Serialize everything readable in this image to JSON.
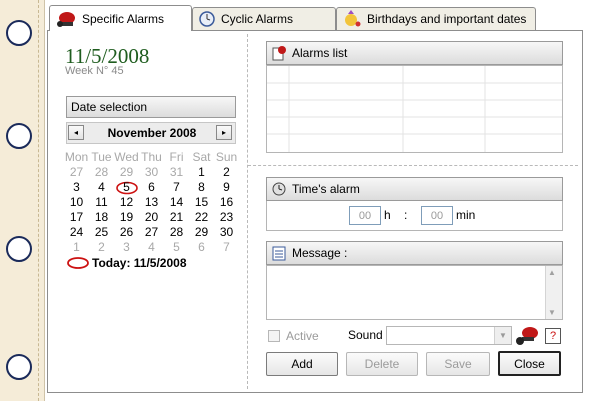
{
  "tabs": [
    {
      "label": "Specific Alarms",
      "icon": "alarm-bell-icon"
    },
    {
      "label": "Cyclic Alarms",
      "icon": "clock-icon"
    },
    {
      "label": "Birthdays and important dates",
      "icon": "birthday-icon"
    }
  ],
  "date_header": {
    "date": "11/5/2008",
    "week": "Week N° 45"
  },
  "date_selection": {
    "title": "Date selection",
    "month_label": "November 2008",
    "prev": "◂",
    "next": "▸"
  },
  "calendar": {
    "weekdays": [
      "Mon",
      "Tue",
      "Wed",
      "Thu",
      "Fri",
      "Sat",
      "Sun"
    ],
    "weeks": [
      [
        "27",
        "28",
        "29",
        "30",
        "31",
        "1",
        "2"
      ],
      [
        "3",
        "4",
        "5",
        "6",
        "7",
        "8",
        "9"
      ],
      [
        "10",
        "11",
        "12",
        "13",
        "14",
        "15",
        "16"
      ],
      [
        "17",
        "18",
        "19",
        "20",
        "21",
        "22",
        "23"
      ],
      [
        "24",
        "25",
        "26",
        "27",
        "28",
        "29",
        "30"
      ],
      [
        "1",
        "2",
        "3",
        "4",
        "5",
        "6",
        "7"
      ]
    ],
    "selected_day": "5",
    "today_label": "Today: 11/5/2008"
  },
  "alarms_list": {
    "title": "Alarms list"
  },
  "times_alarm": {
    "title": "Time's alarm",
    "hours": "00",
    "hours_unit": "h",
    "separator": ":",
    "minutes": "00",
    "minutes_unit": "min"
  },
  "message": {
    "title": "Message :"
  },
  "options": {
    "active_label": "Active",
    "sound_label": "Sound :",
    "help_label": "?"
  },
  "buttons": {
    "add": "Add",
    "delete": "Delete",
    "save": "Save",
    "close": "Close"
  },
  "colors": {
    "date_green": "#1f5d1f",
    "ring_blue": "#1a2a5a",
    "today_red": "#cc1111"
  }
}
